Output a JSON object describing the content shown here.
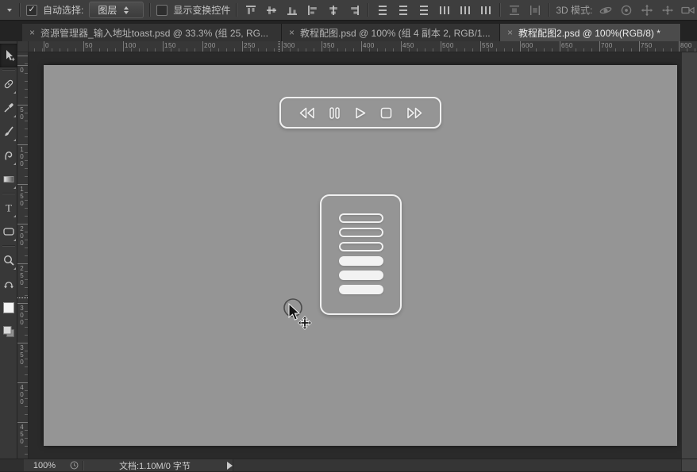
{
  "colors": {
    "ui_panel": "#3e3e3e",
    "pasteboard": "#2a2a2a",
    "document_gray": "#959595",
    "widget_stroke": "#f0f0f0",
    "active_tab": "#4b4b4b"
  },
  "options_bar": {
    "preset_menu_icon": "tool-preset-dropdown",
    "auto_select": {
      "label": "自动选择:",
      "checked": true
    },
    "auto_select_target": {
      "value": "图层"
    },
    "show_transform_controls": {
      "label": "显示变换控件",
      "checked": false
    },
    "align_buttons": [
      {
        "name": "align-top-edges"
      },
      {
        "name": "align-vertical-centers"
      },
      {
        "name": "align-bottom-edges"
      },
      {
        "name": "align-left-edges"
      },
      {
        "name": "align-horizontal-centers"
      },
      {
        "name": "align-right-edges"
      }
    ],
    "distribute_buttons": [
      {
        "name": "distribute-top-edges"
      },
      {
        "name": "distribute-vertical-centers"
      },
      {
        "name": "distribute-bottom-edges"
      },
      {
        "name": "distribute-left-edges"
      },
      {
        "name": "distribute-horizontal-centers"
      },
      {
        "name": "distribute-right-edges"
      }
    ],
    "spacing_buttons": [
      {
        "name": "distribute-vertical-spacing"
      },
      {
        "name": "distribute-horizontal-spacing"
      }
    ],
    "mode_3d": {
      "label": "3D 模式:",
      "buttons": [
        {
          "name": "3d-orbit"
        },
        {
          "name": "3d-roll"
        },
        {
          "name": "3d-pan"
        },
        {
          "name": "3d-slide"
        },
        {
          "name": "3d-camera"
        }
      ]
    }
  },
  "tabs": [
    {
      "title": "资源管理器_输入地址toast.psd @ 33.3% (组 25, RG...",
      "active": false
    },
    {
      "title": "教程配图.psd @ 100% (组 4 副本 2, RGB/1...",
      "active": false
    },
    {
      "title": "教程配图2.psd @ 100%(RGB/8) *",
      "active": true
    }
  ],
  "toolbar": {
    "tools": [
      {
        "name": "move-tool",
        "selected": true,
        "flyout": false
      },
      {
        "name": "healing-brush-tool",
        "selected": false,
        "flyout": true
      },
      {
        "name": "eyedropper-tool",
        "selected": false,
        "flyout": true
      },
      {
        "name": "brush-tool",
        "selected": false,
        "flyout": true
      },
      {
        "name": "smudge-tool",
        "selected": false,
        "flyout": true
      },
      {
        "name": "gradient-tool",
        "selected": false,
        "flyout": true
      },
      {
        "name": "type-tool",
        "selected": false,
        "flyout": true
      },
      {
        "name": "rounded-rectangle-tool",
        "selected": false,
        "flyout": true
      },
      {
        "name": "zoom-tool",
        "selected": false,
        "flyout": true
      },
      {
        "name": "swap-colors-icon",
        "selected": false,
        "flyout": false
      },
      {
        "name": "foreground-color-swatch",
        "selected": false,
        "flyout": false
      },
      {
        "name": "background-color-swatch",
        "selected": false,
        "flyout": false
      }
    ]
  },
  "rulers": {
    "top_labels": [
      "0",
      "50",
      "100",
      "150",
      "200",
      "250",
      "300",
      "350",
      "400",
      "450",
      "500",
      "550",
      "600",
      "650",
      "700",
      "750",
      "800"
    ],
    "left_labels": [
      "0",
      "50",
      "100",
      "150",
      "200",
      "250",
      "300",
      "350",
      "400",
      "450"
    ]
  },
  "canvas": {
    "player_widget": {
      "buttons": [
        {
          "name": "rewind-button"
        },
        {
          "name": "pause-button"
        },
        {
          "name": "play-button"
        },
        {
          "name": "stop-button"
        },
        {
          "name": "fast-forward-button"
        }
      ]
    },
    "list_widget": {
      "bars": [
        {
          "style": "outline"
        },
        {
          "style": "outline"
        },
        {
          "style": "outline"
        },
        {
          "style": "filled"
        },
        {
          "style": "filled"
        },
        {
          "style": "filled"
        }
      ]
    },
    "cursor": {
      "name": "move-cursor-with-circle"
    }
  },
  "status_bar": {
    "zoom_level": "100%",
    "doc_info": "文档:1.10M/0 字节"
  }
}
